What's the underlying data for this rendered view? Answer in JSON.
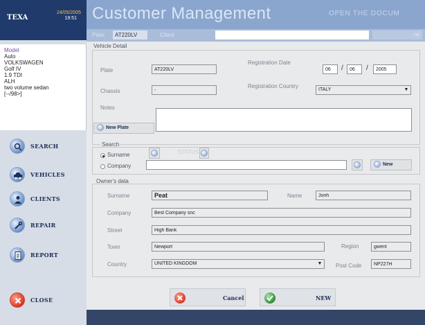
{
  "brand": {
    "logo": "TEXA",
    "date": "24/05/2005",
    "time": "19:51"
  },
  "header": {
    "title": "Customer Management",
    "open_doc": "OPEN THE DOCUM"
  },
  "subheader": {
    "plate_label": "Plate",
    "plate_value": "AT220LV",
    "client_label": "Client",
    "right_label": "ne"
  },
  "model": {
    "label": "Model",
    "lines": [
      "Auto",
      "VOLKSWAGEN",
      "Golf IV",
      "1.9 TDI",
      "ALH",
      "two volume sedan",
      "[--/98>]"
    ]
  },
  "nav": {
    "search": "SEARCH",
    "vehicles": "VEHICLES",
    "clients": "CLIENTS",
    "repair": "REPAIR",
    "report": "REPORT",
    "close": "CLOSE"
  },
  "vehicle_detail": {
    "section": "Vehicle Detail",
    "plate_label": "Plate",
    "plate_value": "AT220LV",
    "reg_date_label": "Registration Date",
    "reg_day": "06",
    "reg_month": "06",
    "reg_year": "2005",
    "date_sep": "/",
    "chassis_label": "Chassis",
    "chassis_value": "-",
    "reg_country_label": "Registration Country",
    "reg_country_value": "ITALY",
    "notes_label": "Notes",
    "new_plate": "New Plate"
  },
  "search": {
    "section": "Search",
    "surname_option": "Surname",
    "company_option": "Company",
    "faded_label": "STATUS",
    "new_label": "New"
  },
  "owner": {
    "section": "Owner's data",
    "surname_label": "Surname",
    "surname_value": "Peat",
    "name_label": "Name",
    "name_value": "Jonh",
    "company_label": "Company",
    "company_value": "Best Company snc",
    "street_label": "Street",
    "street_value": "High Bank",
    "town_label": "Town",
    "town_value": "Newport",
    "region_label": "Region",
    "region_value": "gwent",
    "country_label": "Country",
    "country_value": "UNITED KINGDOM",
    "postcode_label": "Post Code",
    "postcode_value": "NP227H"
  },
  "actions": {
    "cancel": "Cancel",
    "new": "NEW"
  },
  "colors": {
    "brand_bg": "#1f3a6b",
    "header_bg": "#8aa6cf",
    "sidebar_bg": "#d7dde6",
    "panel_bg": "#e9eaeb",
    "footer_bg": "#334668",
    "close_red": "#d83a22",
    "ok_green": "#2e8b3a"
  }
}
